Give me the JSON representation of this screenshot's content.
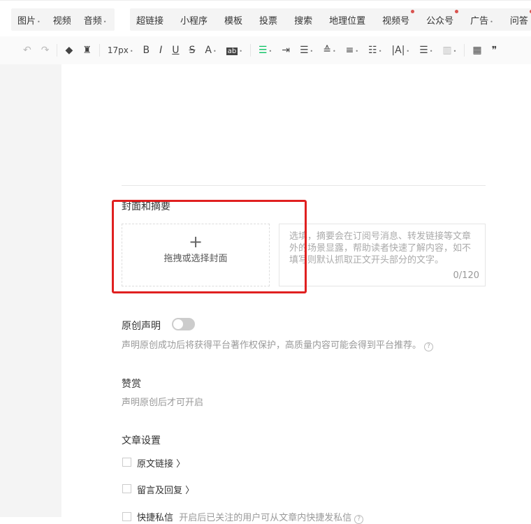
{
  "insert_bar": {
    "group1": [
      {
        "label": "图片",
        "caret": true
      },
      {
        "label": "视频",
        "caret": false
      },
      {
        "label": "音频",
        "caret": true
      }
    ],
    "group2": [
      {
        "label": "超链接"
      },
      {
        "label": "小程序"
      },
      {
        "label": "模板"
      },
      {
        "label": "投票"
      },
      {
        "label": "搜索"
      },
      {
        "label": "地理位置"
      },
      {
        "label": "视频号",
        "dot": true
      },
      {
        "label": "公众号",
        "dot": true
      },
      {
        "label": "广告",
        "caret": true
      },
      {
        "label": "问答",
        "dot": true
      }
    ]
  },
  "toolbar": {
    "font_size": "17px",
    "bold": "B",
    "italic": "I",
    "underline": "U",
    "strike": "S",
    "font_color": "A",
    "bg_color": "ab",
    "quote": "❞"
  },
  "cover_section": {
    "title": "封面和摘要",
    "cover_button": "拖拽或选择封面",
    "plus": "+",
    "abstract_placeholder": "选填，摘要会在订阅号消息、转发链接等文章外的场景显露，帮助读者快速了解内容，如不填写则默认抓取正文开头部分的文字。",
    "counter": "0/120"
  },
  "original": {
    "title": "原创声明",
    "enabled": false,
    "desc": "声明原创成功后将获得平台著作权保护，高质量内容可能会得到平台推荐。",
    "help": "?"
  },
  "reward": {
    "title": "赞赏",
    "desc": "声明原创后才可开启"
  },
  "article_settings": {
    "title": "文章设置",
    "items": [
      {
        "label": "原文链接 〉",
        "checked": false
      },
      {
        "label": "留言及回复 〉",
        "checked": false
      },
      {
        "label": "快捷私信",
        "desc": "开启后已关注的用户可从文章内快捷发私信",
        "checked": false
      }
    ]
  }
}
